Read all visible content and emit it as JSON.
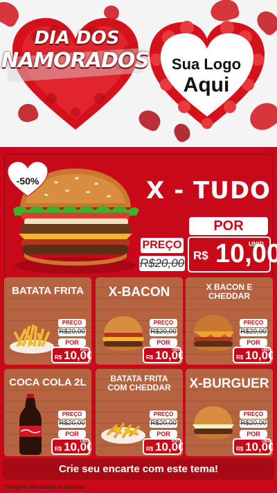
{
  "header": {
    "title_line1": "DIA DOS",
    "title_line2": "NAMORADOS",
    "logo_line1": "Sua Logo",
    "logo_line2": "Aqui"
  },
  "hero": {
    "name": "X - TUDO",
    "discount": "-50%",
    "preco_label": "PREÇO",
    "old_price": "R$20,00",
    "por_label": "POR",
    "currency": "R$",
    "new_price": "10,00",
    "unit": "UNID"
  },
  "cards": [
    {
      "name": "BATATA FRITA",
      "food": "fries",
      "preco_label": "PREÇO",
      "old_price": "R$20,00",
      "por_label": "POR",
      "currency": "R$",
      "new_price": "10,00",
      "unit": "POC"
    },
    {
      "name": "X-BACON",
      "food": "burger",
      "preco_label": "PREÇO",
      "old_price": "R$20,00",
      "por_label": "POR",
      "currency": "R$",
      "new_price": "10,00",
      "unit": "UNID"
    },
    {
      "name": "X BACON E CHEDDAR",
      "food": "burger-cheddar",
      "preco_label": "PREÇO",
      "old_price": "R$20,00",
      "por_label": "POR",
      "currency": "R$",
      "new_price": "10,00",
      "unit": "UNID"
    },
    {
      "name": "COCA COLA 2L",
      "food": "soda",
      "preco_label": "PREÇO",
      "old_price": "R$20,00",
      "por_label": "POR",
      "currency": "R$",
      "new_price": "10,00",
      "unit": "UNID"
    },
    {
      "name": "BATATA FRITA COM CHEDDAR",
      "food": "fries-cheddar",
      "preco_label": "PREÇO",
      "old_price": "R$20,00",
      "por_label": "POR",
      "currency": "R$",
      "new_price": "10,00",
      "unit": "POC"
    },
    {
      "name": "X-BURGUER",
      "food": "burger-simple",
      "preco_label": "PREÇO",
      "old_price": "R$20,00",
      "por_label": "POR",
      "currency": "R$",
      "new_price": "10,00",
      "unit": "UNID"
    }
  ],
  "footer": {
    "cta": "Crie seu encarte com este tema!",
    "disclaimer": "*Imagens Meramente Ilustrativas"
  },
  "colors": {
    "primary_red": "#c8091a",
    "dark_red": "#a80a15",
    "card_brown": "#b25e3e",
    "white": "#ffffff"
  }
}
